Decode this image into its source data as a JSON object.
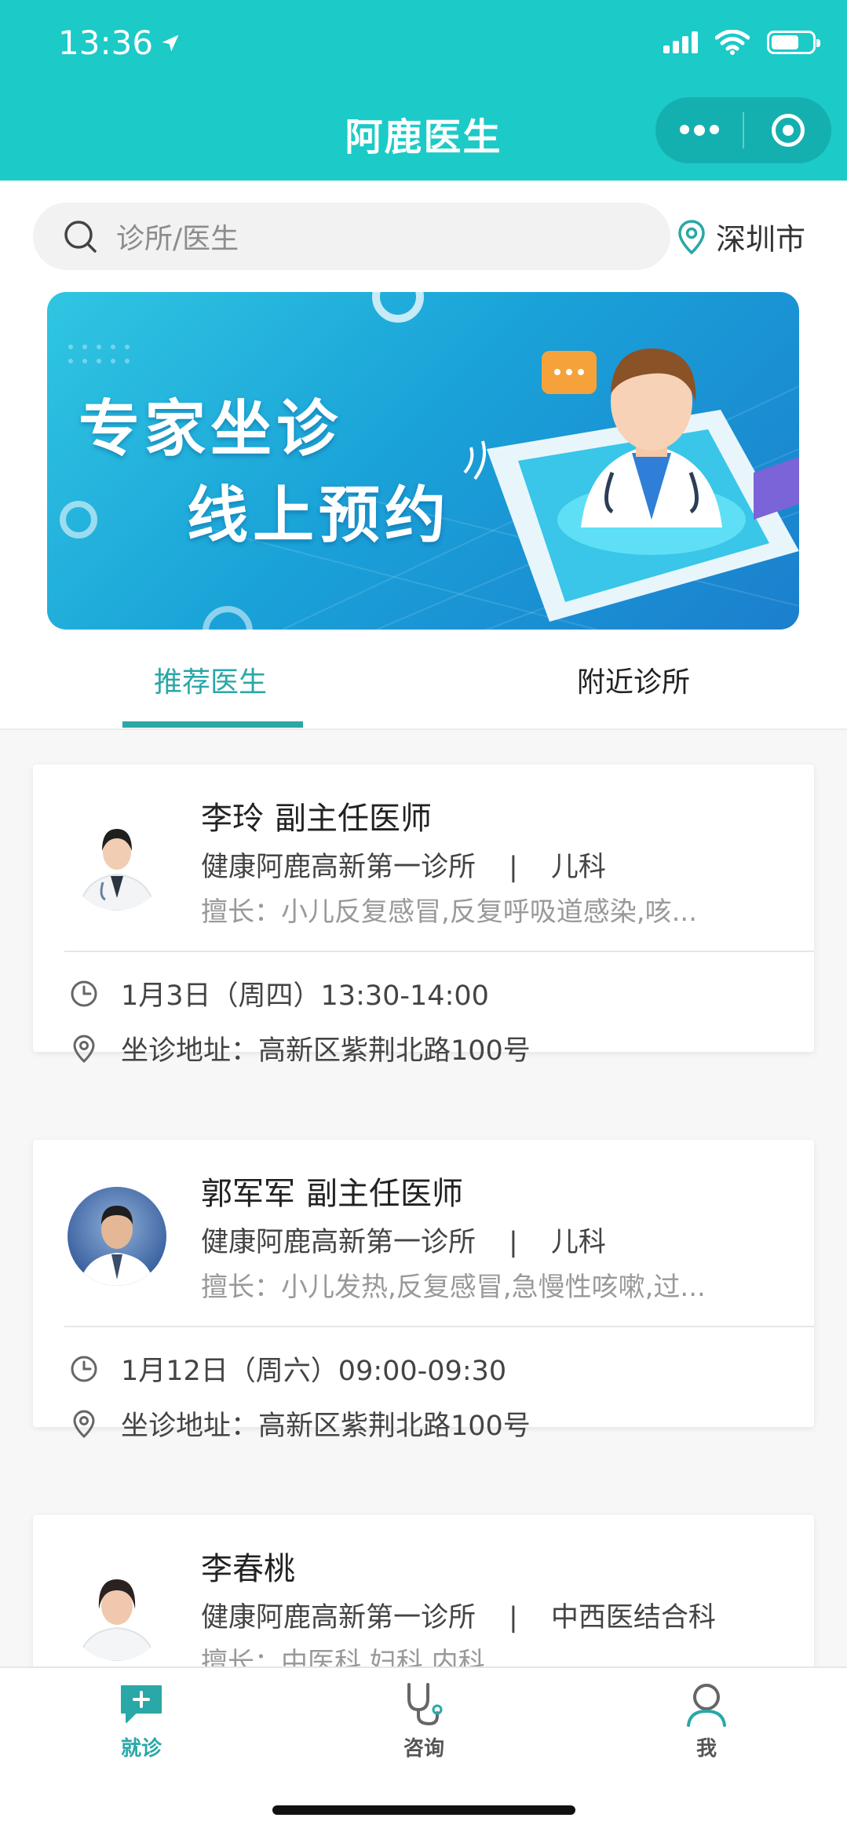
{
  "status_bar": {
    "time": "13:36"
  },
  "header": {
    "title": "阿鹿医生"
  },
  "search": {
    "placeholder": "诊所/医生",
    "city": "深圳市"
  },
  "banner": {
    "line1": "专家坐诊",
    "line2": "线上预约"
  },
  "tabs": [
    {
      "label": "推荐医生",
      "active": true
    },
    {
      "label": "附近诊所",
      "active": false
    }
  ],
  "doctors": [
    {
      "name": "李玲",
      "title": "副主任医师",
      "clinic": "健康阿鹿高新第一诊所",
      "separator": "|",
      "department": "儿科",
      "specialty": "擅长：小儿反复感冒,反复呼吸道感染,咳...",
      "time": "1月3日（周四）13:30-14:00",
      "address": "坐诊地址：高新区紫荆北路100号"
    },
    {
      "name": "郭军军",
      "title": "副主任医师",
      "clinic": "健康阿鹿高新第一诊所",
      "separator": "|",
      "department": "儿科",
      "specialty": "擅长：小儿发热,反复感冒,急慢性咳嗽,过...",
      "time": "1月12日（周六）09:00-09:30",
      "address": "坐诊地址：高新区紫荆北路100号"
    },
    {
      "name": "李春桃",
      "title": "",
      "clinic": "健康阿鹿高新第一诊所",
      "separator": "|",
      "department": "中西医结合科",
      "specialty": "擅长：中医科,妇科,内科"
    }
  ],
  "bottom_nav": [
    {
      "label": "就诊",
      "icon": "chat-plus-icon",
      "active": true
    },
    {
      "label": "咨询",
      "icon": "stethoscope-icon",
      "active": false
    },
    {
      "label": "我",
      "icon": "user-icon",
      "active": false
    }
  ],
  "colors": {
    "primary": "#1ccac8",
    "accent": "#2aa7a7",
    "muted": "#999999"
  }
}
